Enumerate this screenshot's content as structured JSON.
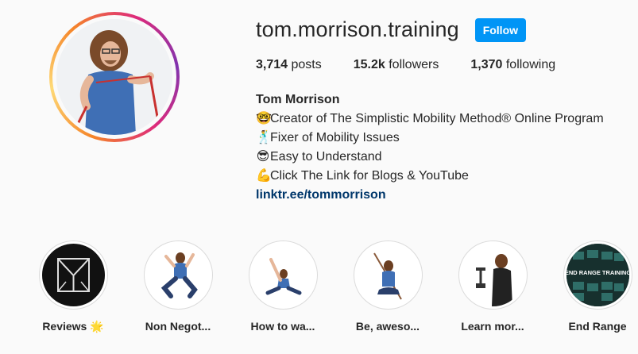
{
  "profile": {
    "username": "tom.morrison.training",
    "follow_label": "Follow"
  },
  "stats": {
    "posts_count": "3,714",
    "posts_label": " posts",
    "followers_count": "15.2k",
    "followers_label": " followers",
    "following_count": "1,370",
    "following_label": " following"
  },
  "bio": {
    "name": "Tom Morrison",
    "lines": [
      {
        "emoji": "🤓",
        "text": "Creator of The Simplistic Mobility Method® Online Program"
      },
      {
        "emoji": "🕺",
        "text": "Fixer of Mobility Issues"
      },
      {
        "emoji": "😎",
        "text": "Easy to Understand"
      },
      {
        "emoji": "💪",
        "text": "Click The Link for Blogs & YouTube"
      }
    ],
    "link": "linktr.ee/tommorrison"
  },
  "highlights": [
    {
      "label": "Reviews 🌟"
    },
    {
      "label": "Non Negot..."
    },
    {
      "label": "How to wa..."
    },
    {
      "label": "Be, aweso..."
    },
    {
      "label": "Learn mor..."
    },
    {
      "label": "End Range"
    }
  ],
  "highlight_text": {
    "end_range_title": "END RANGE TRAINING"
  },
  "colors": {
    "accent": "#0095f6",
    "link": "#00376b",
    "text": "#262626",
    "background": "#fafafa"
  }
}
